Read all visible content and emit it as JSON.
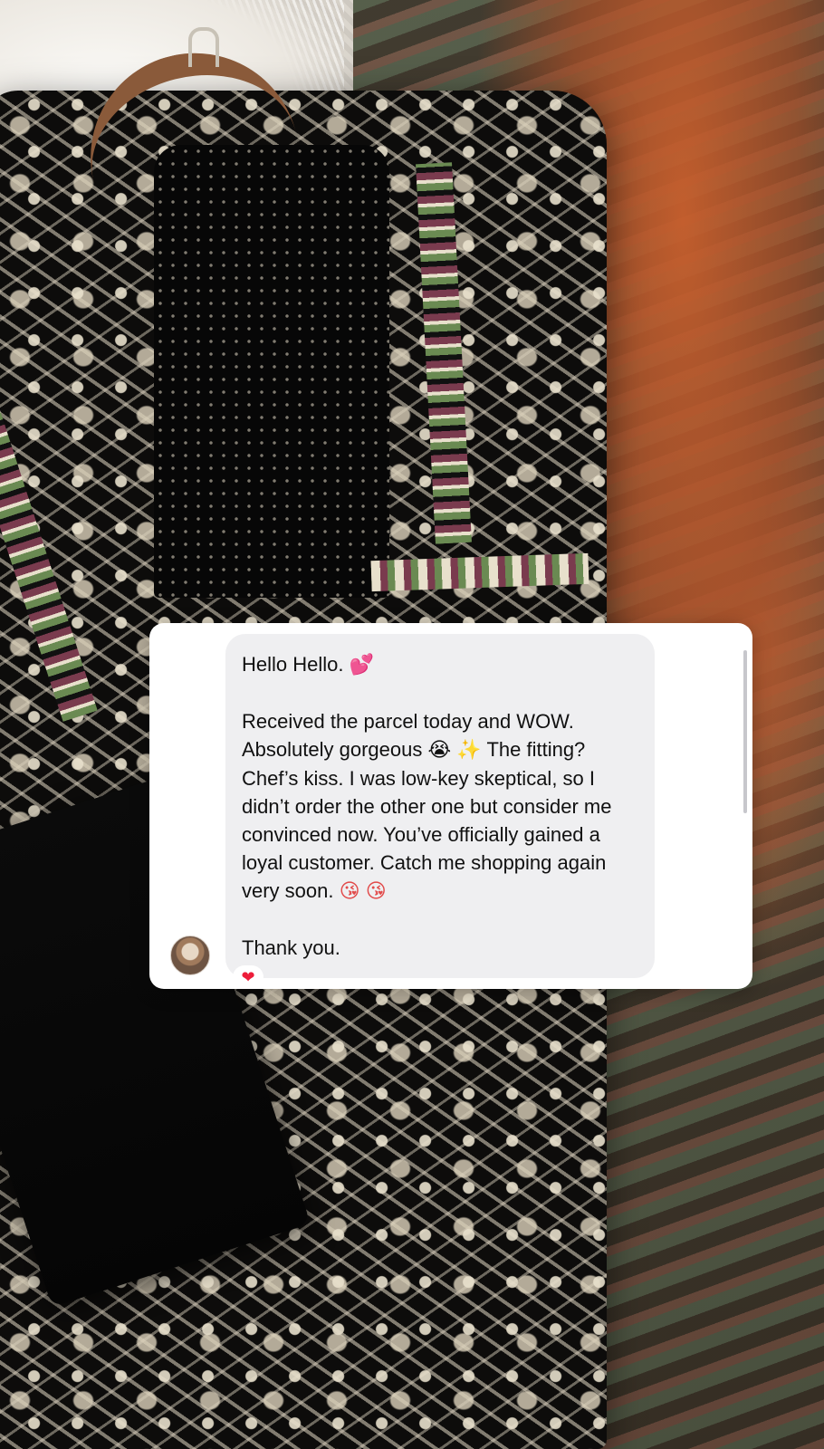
{
  "message": {
    "greeting": "Hello Hello.",
    "greeting_emoji": "💕",
    "body_part1": "Received the parcel today and WOW. Absolutely gorgeous",
    "body_emoji1": "😭",
    "body_emoji2": "✨",
    "body_part2": " The fitting? Chef’s kiss. I was low-key skeptical, so I didn’t order the other one but consider me convinced now. You’ve officially gained a loyal customer. Catch me shopping again very soon.",
    "body_emoji3": "😘",
    "body_emoji4": "😘",
    "closing": "Thank you.",
    "reaction": "❤"
  },
  "icons": {
    "avatar": "avatar-photo",
    "reaction": "heart-icon"
  },
  "colors": {
    "card_background": "#ffffff",
    "bubble_background": "#efeff1",
    "text": "#111111",
    "reaction_heart": "#ed1d3a"
  }
}
